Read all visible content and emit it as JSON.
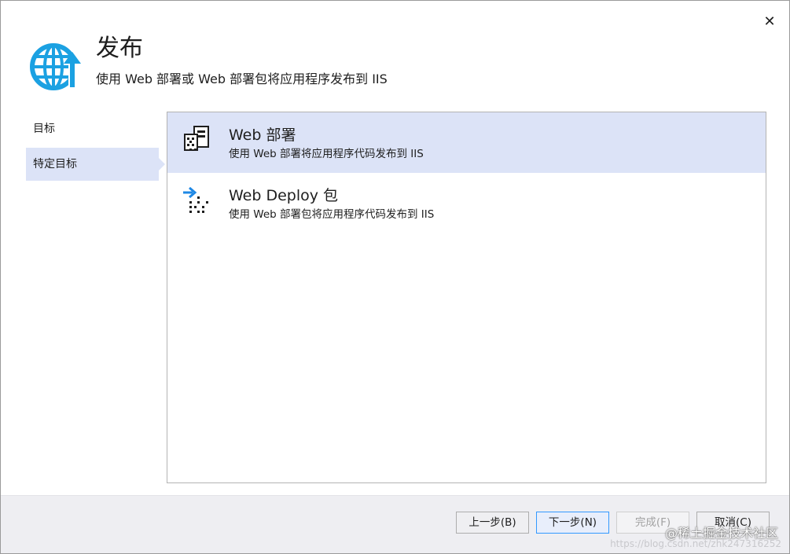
{
  "window": {
    "close_glyph": "✕"
  },
  "header": {
    "title": "发布",
    "subtitle": "使用 Web 部署或 Web 部署包将应用程序发布到 IIS",
    "icon": "globe-publish-icon",
    "accent_color": "#1ba1e2"
  },
  "nav": {
    "items": [
      {
        "label": "目标",
        "selected": false
      },
      {
        "label": "特定目标",
        "selected": true
      }
    ]
  },
  "options": [
    {
      "title": "Web 部署",
      "description": "使用 Web 部署将应用程序代码发布到 IIS",
      "icon": "web-deploy-server-icon",
      "selected": true
    },
    {
      "title": "Web Deploy 包",
      "description": "使用 Web 部署包将应用程序代码发布到 IIS",
      "icon": "web-deploy-package-icon",
      "selected": false
    }
  ],
  "footer": {
    "back_label": "上一步(B)",
    "next_label": "下一步(N)",
    "finish_label": "完成(F)",
    "cancel_label": "取消(C)"
  },
  "watermark": {
    "text": "@稀土掘金技术社区",
    "url": "https://blog.csdn.net/zhk247316252"
  },
  "colors": {
    "selection": "#dce3f7",
    "footer_bg": "#eeeef2",
    "primary_border": "#3399ff"
  }
}
